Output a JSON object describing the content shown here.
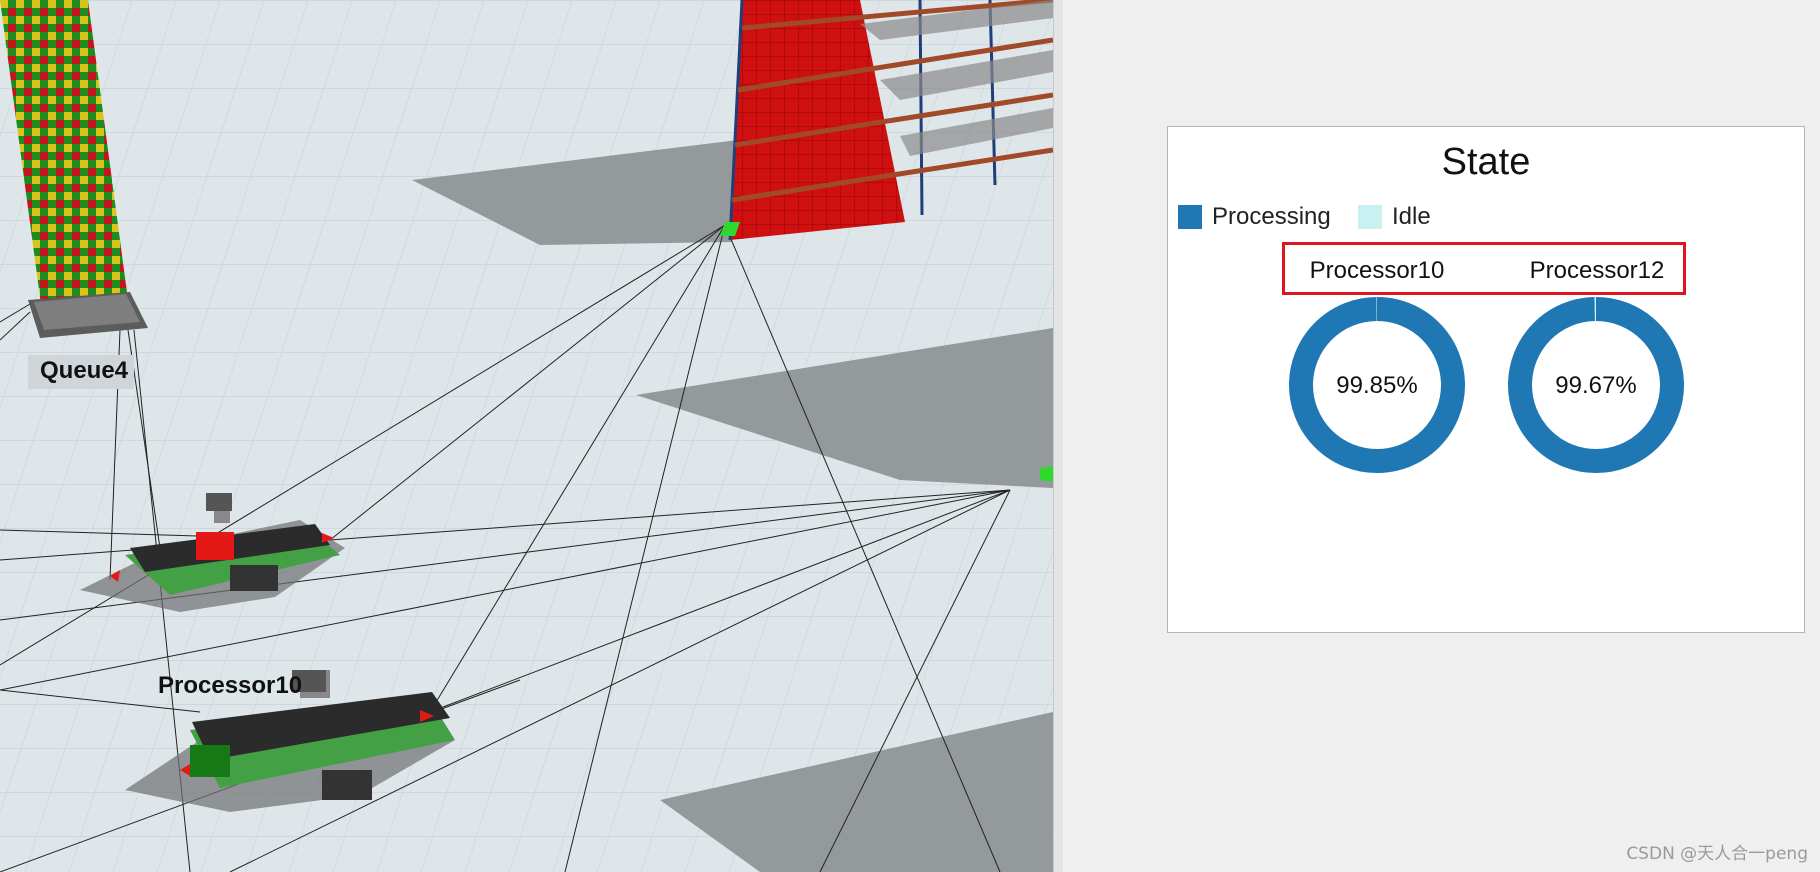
{
  "scene": {
    "queue_label": "Queue4",
    "processor_label": "Processor10"
  },
  "chart": {
    "title": "State",
    "legend": [
      {
        "label": "Processing",
        "color": "#1f77b4"
      },
      {
        "label": "Idle",
        "color": "#c9f1f1"
      }
    ],
    "highlight_color": "#e0141e"
  },
  "chart_data": {
    "type": "pie",
    "title": "State",
    "legend": [
      "Processing",
      "Idle"
    ],
    "series": [
      {
        "name": "Processor10",
        "values": {
          "Processing": 99.85,
          "Idle": 0.15
        },
        "label": "99.85%"
      },
      {
        "name": "Processor12",
        "values": {
          "Processing": 99.67,
          "Idle": 0.33
        },
        "label": "99.67%"
      }
    ],
    "colors": {
      "Processing": "#1f77b4",
      "Idle": "#c9f1f1"
    }
  },
  "watermark": "CSDN @天人合一peng"
}
